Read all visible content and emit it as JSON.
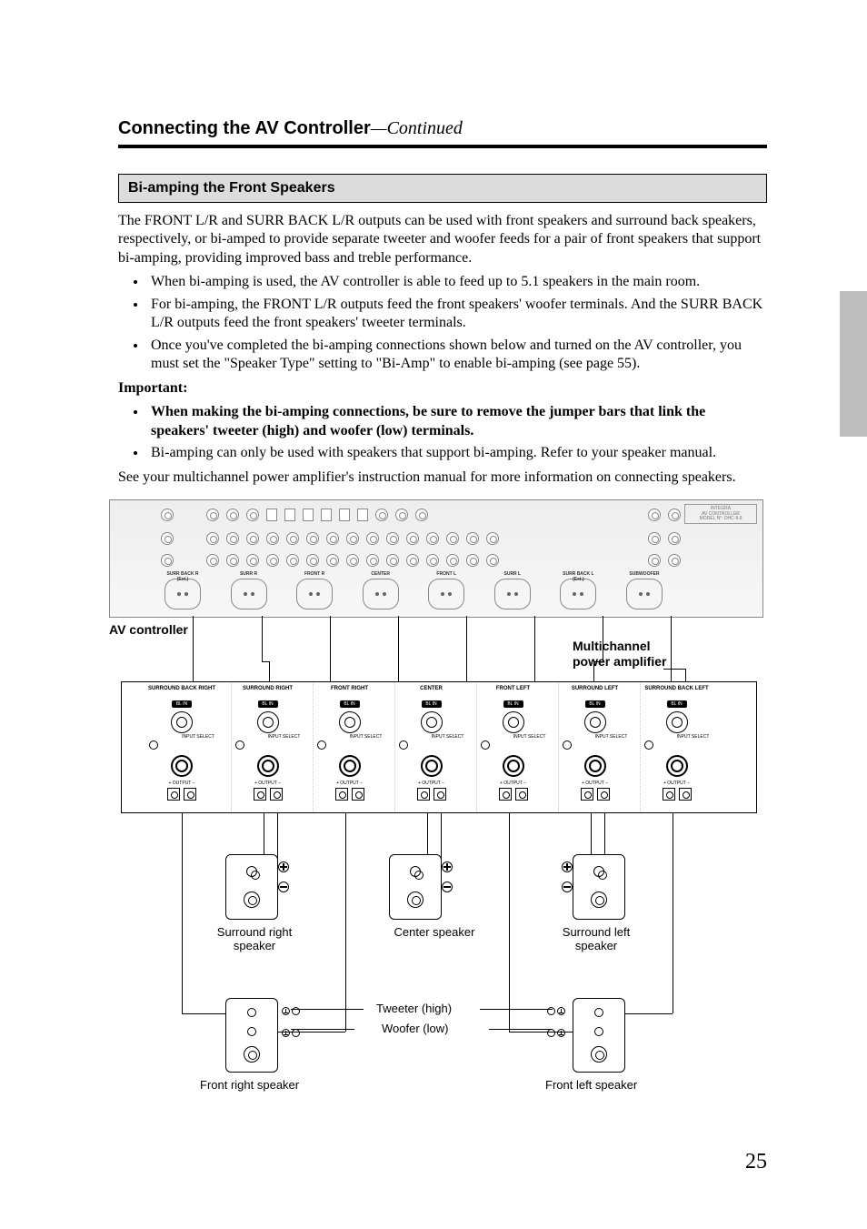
{
  "header": {
    "title": "Connecting the AV Controller",
    "continued": "—Continued"
  },
  "section": {
    "title": "Bi-amping the Front Speakers"
  },
  "intro": "The FRONT L/R and SURR BACK L/R outputs can be used with front speakers and surround back speakers, respectively, or bi-amped to provide separate tweeter and woofer feeds for a pair of front speakers that support bi-amping, providing improved bass and treble performance.",
  "bullets1": [
    "When bi-amping is used, the AV controller is able to feed up to 5.1 speakers in the main room.",
    "For bi-amping, the FRONT L/R outputs feed the front speakers' woofer terminals. And the SURR BACK L/R outputs feed the front speakers' tweeter terminals.",
    "Once you've completed the bi-amping connections shown below and turned on the AV controller, you must set the \"Speaker Type\" setting to \"Bi-Amp\" to enable bi-amping (see page 55)."
  ],
  "important_label": "Important:",
  "bullets2": [
    {
      "text": "When making the bi-amping connections, be sure to remove the jumper bars that link the speakers' tweeter (high) and woofer (low) terminals.",
      "bold": true
    },
    {
      "text": "Bi-amping can only be used with speakers that support bi-amping. Refer to your speaker manual.",
      "bold": false
    }
  ],
  "closing": "See your multichannel power amplifier's instruction manual for more information on connecting speakers.",
  "diagram": {
    "av_label": "AV controller",
    "amp_label_line1": "Multichannel",
    "amp_label_line2": "power amplifier",
    "preout": [
      "SURR BACK R",
      "SURR R",
      "FRONT R",
      "CENTER",
      "FRONT L",
      "SURR L",
      "SURR BACK L",
      "SUBWOOFER"
    ],
    "preout_ext": "(Ext.)",
    "amp_channels": [
      "SURROUND BACK RIGHT",
      "SURROUND RIGHT",
      "FRONT RIGHT",
      "CENTER",
      "FRONT LEFT",
      "SURROUND LEFT",
      "SURROUND BACK LEFT"
    ],
    "amp_bl_in": "BL IN",
    "amp_input_select": "INPUT SELECT",
    "amp_output": "OUTPUT",
    "avc_right_box_l1": "INTEGRA",
    "avc_right_box_l2": "AV CONTROLLER",
    "avc_right_box_l3": "MODEL N°: DHC-9.9",
    "speakers": {
      "surr_right": "Surround right speaker",
      "center": "Center speaker",
      "surr_left": "Surround left speaker",
      "front_right": "Front right speaker",
      "front_left": "Front left speaker",
      "tweeter": "Tweeter (high)",
      "woofer": "Woofer (low)"
    }
  },
  "page_number": "25"
}
